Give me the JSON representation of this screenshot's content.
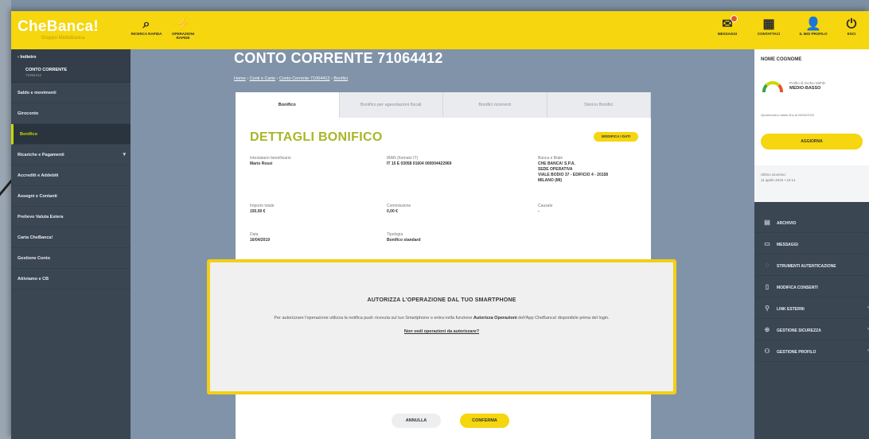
{
  "brand": {
    "name": "CheBanca!",
    "subtitle": "Gruppo Mediobanca"
  },
  "topbar": {
    "left_items": [
      {
        "icon": "search-icon",
        "glyph": "⌕",
        "label": "RICERCA RAPIDA"
      },
      {
        "icon": "lightning-icon",
        "glyph": "⚡",
        "label": "OPERAZIONI RAPIDE"
      }
    ],
    "right_items": [
      {
        "icon": "mail-icon",
        "glyph": "✉",
        "label": "MESSAGGI"
      },
      {
        "icon": "contacts-icon",
        "glyph": "▦",
        "label": "CONTATTACI"
      },
      {
        "icon": "user-icon",
        "glyph": "👤",
        "label": "IL MIO PROFILO"
      },
      {
        "icon": "exit-icon",
        "glyph": "⏻",
        "label": "ESCI"
      }
    ]
  },
  "sidebar": {
    "group": {
      "title": "Indietro",
      "sub": "CONTO CORRENTE",
      "subsub": "71064412"
    },
    "items": [
      {
        "label": "Saldo e movimenti"
      },
      {
        "label": "Giroconto"
      },
      {
        "label": "Bonifico",
        "active": true
      },
      {
        "label": "Ricariche e Pagamenti",
        "chevron": "▾"
      },
      {
        "label": "Accrediti e Addebiti"
      },
      {
        "label": "Assegni e Contanti"
      },
      {
        "label": "Prelievo Valuta Estera"
      },
      {
        "label": "Carta CheBanca!"
      },
      {
        "label": "Gestione Conto"
      },
      {
        "label": "Attiviamo e CB"
      }
    ]
  },
  "main": {
    "title": "CONTO CORRENTE 71064412",
    "breadcrumbs": [
      "Home",
      "Conti e Carte",
      "Conto Corrente 71064412",
      "Bonifici"
    ],
    "tabs": [
      "Bonifico",
      "Bonifico per agevolazioni fiscali",
      "Bonifici ricorrenti",
      "Storico Bonifici"
    ],
    "section_title": "DETTAGLI BONIFICO",
    "modify_label": "MODIFICA I DATI",
    "fields": {
      "beneficiary_label": "Intestatario beneficiario",
      "beneficiary_value": "Mario Rossi",
      "iban_label": "IBAN (formato IT)",
      "iban_value": "IT 15 E 03058 01604 000004422969",
      "bank_label": "Banca e filiale",
      "bank_value_1": "CHE BANCA! S.P.A.",
      "bank_value_2": "SEDE OPERATIVA",
      "bank_value_3": "VIALE BODIO 37 - EDIFICIO 4 - 20158",
      "bank_value_4": "MILANO (MI)",
      "amount_label": "Importo totale",
      "amount_value": "150,00 €",
      "fee_label": "Commissione",
      "fee_value": "0,00 €",
      "reason_label": "Causale",
      "reason_value": "-",
      "date_label": "Data",
      "date_value": "16/04/2019",
      "type_label": "Tipologia",
      "type_value": "Bonifico standard"
    },
    "cancel_label": "ANNULLA",
    "confirm_label": "CONFERMA"
  },
  "modal": {
    "title": "AUTORIZZA L'OPERAZIONE DAL TUO SMARTPHONE",
    "text_before": "Per autorizzare l'operazione utilizza la notifica push ricevuta sul tuo Smartphone o entra nella funzione ",
    "text_bold": "Autorizza Operazioni",
    "text_after": " dell'App CheBanca! disponibile prima del login.",
    "link": "Non vedi operazioni da autorizzare?"
  },
  "right_panel": {
    "name": "NOME COGNOME",
    "profile_label": "Profilo di rischio MiFID",
    "profile_value": "MEDIO-BASSO",
    "questionnaire": "Questionario valido fino al 08/02/2019",
    "update_label": "AGGIORNA",
    "last_access_label": "Ultimo accesso:",
    "last_access_value": "11 aprile 2019 • 10:14",
    "items": [
      {
        "icon": "archive-icon",
        "glyph": "▤",
        "label": "ARCHIVIO"
      },
      {
        "icon": "messages-icon",
        "glyph": "▭",
        "label": "MESSAGGI"
      },
      {
        "icon": "shield-icon",
        "glyph": "◌",
        "label": "STRUMENTI AUTENTICAZIONE"
      },
      {
        "icon": "document-icon",
        "glyph": "▯",
        "label": "MODIFICA CONSENTI"
      },
      {
        "icon": "link-icon",
        "glyph": "⚲",
        "label": "LINK ESTERNI",
        "chevron": "›"
      },
      {
        "icon": "lock-icon",
        "glyph": "⊕",
        "label": "GESTIONE SICUREZZA",
        "chevron": "›"
      },
      {
        "icon": "profile-icon",
        "glyph": "⚇",
        "label": "GESTIONE PROFILO",
        "chevron": "›"
      }
    ]
  }
}
